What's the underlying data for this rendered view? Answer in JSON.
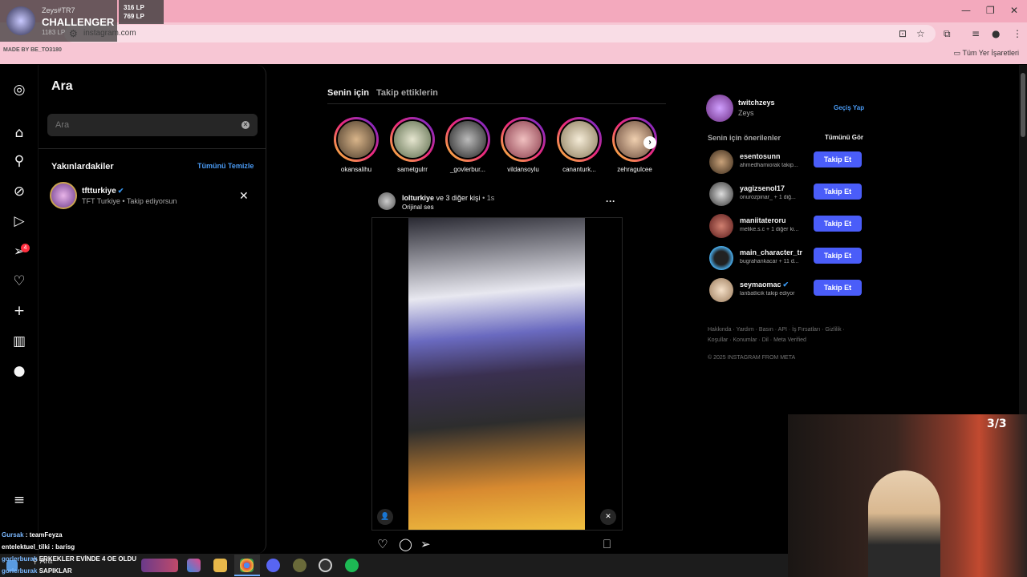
{
  "browser": {
    "url": "instagram.com",
    "bookmarks_label": "Tüm Yer İşaretleri",
    "window_controls": [
      "—",
      "❐",
      "✕"
    ]
  },
  "stream_overlay": {
    "rank_user": "Zeys#TR7",
    "rank_name": "CHALLENGER",
    "rank_lp": "1183 LP",
    "lp_lines": [
      "316 LP",
      "769 LP"
    ],
    "made_by": "MADE BY BE_TO3180",
    "cam_counter": "3/3",
    "chat": [
      {
        "user": "Gursak",
        "text": "teamFeyza"
      },
      {
        "user": "entelektuel_tilki",
        "text": "barisg"
      },
      {
        "user": "gorlerburak",
        "text": "ERKEKLER EVİNDE 4 OE OLDU"
      },
      {
        "user": "gorlerburak",
        "text": "SAPIKLAR"
      }
    ]
  },
  "search_panel": {
    "title": "Ara",
    "placeholder": "Ara",
    "recent_label": "Yakınlardakiler",
    "clear_all": "Tümünü Temizle",
    "recent": [
      {
        "name": "tftturkiye",
        "sub": "TFT Turkiye • Takip ediyorsun",
        "verified": true
      }
    ]
  },
  "nav": {
    "icons": [
      "instagram-logo-icon",
      "home-icon",
      "search-icon",
      "explore-icon",
      "reels-icon",
      "messages-icon",
      "notifications-icon",
      "create-icon",
      "dashboard-icon",
      "profile-icon",
      "more-icon"
    ],
    "messages_badge": "4"
  },
  "feed": {
    "tab_for_you": "Senin için",
    "tab_following": "Takip ettiklerin",
    "stories": [
      "okansalihu",
      "sametgulrr",
      "_govlerbur...",
      "vildansoylu",
      "cananturk...",
      "zehragulcee"
    ],
    "post": {
      "author": "lolturkiye",
      "coauthors": "ve 3 diğer kişi",
      "time": "1s",
      "audio": "Orijinal ses"
    }
  },
  "right": {
    "handle": "twitchzeys",
    "name": "Zeys",
    "switch": "Geçiş Yap",
    "suggestions_title": "Senin için önerilenler",
    "see_all": "Tümünü Gör",
    "follow_label": "Takip Et",
    "suggestions": [
      {
        "name": "esentosunn",
        "sub": "ahmedhamiorak takip..."
      },
      {
        "name": "yagizsenol17",
        "sub": "onurozpinar_ + 1 diğ..."
      },
      {
        "name": "maniitateroru",
        "sub": "melike.s.c + 1 diğer ki..."
      },
      {
        "name": "main_character_tr",
        "sub": "bugrahankacar + 11 d..."
      },
      {
        "name": "seymaomac",
        "sub": "lanbatlicik takip ediyor"
      }
    ],
    "footer_line1": "Hakkında · Yardım · Basın · API · İş Fırsatları · Gizlilik ·",
    "footer_line2": "Koşullar · Konumlar · Dil · Meta Verified",
    "copyright": "© 2025 INSTAGRAM FROM META"
  },
  "taskbar": {
    "search_label": "Ara"
  }
}
